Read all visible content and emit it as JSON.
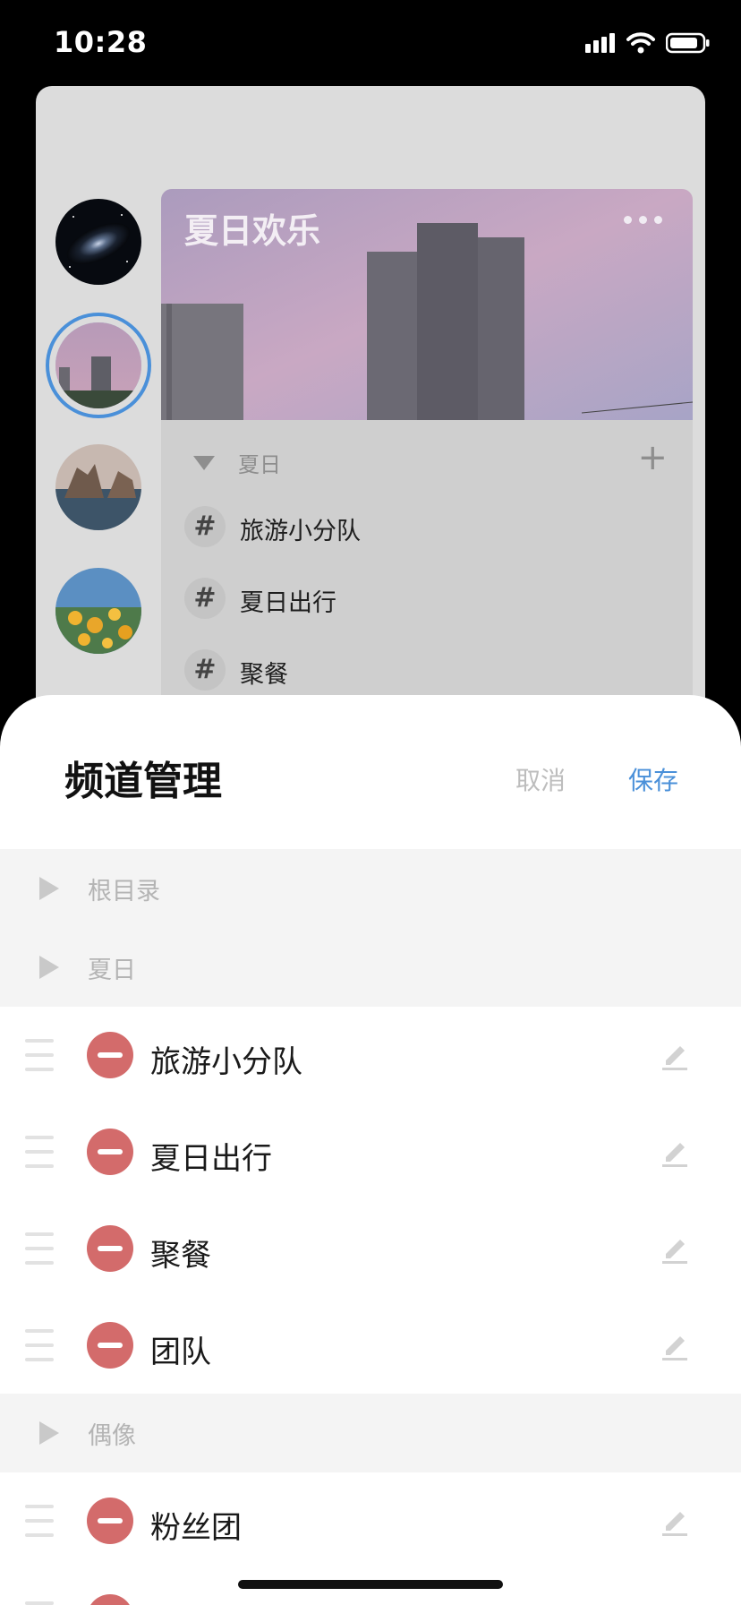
{
  "status_bar": {
    "time": "10:28"
  },
  "server": {
    "name": "夏日欢乐",
    "category": "夏日",
    "channels": [
      {
        "label": "旅游小分队"
      },
      {
        "label": "夏日出行"
      },
      {
        "label": "聚餐"
      }
    ]
  },
  "sheet": {
    "title": "频道管理",
    "cancel_label": "取消",
    "save_label": "保存",
    "folders": [
      {
        "label": "根目录"
      },
      {
        "label": "夏日"
      },
      {
        "label": "偶像"
      }
    ],
    "items": [
      {
        "label": "旅游小分队"
      },
      {
        "label": "夏日出行"
      },
      {
        "label": "聚餐"
      },
      {
        "label": "团队"
      },
      {
        "label": "粉丝团"
      }
    ]
  },
  "colors": {
    "accent": "#4a90d9",
    "remove": "#d36b6b"
  }
}
